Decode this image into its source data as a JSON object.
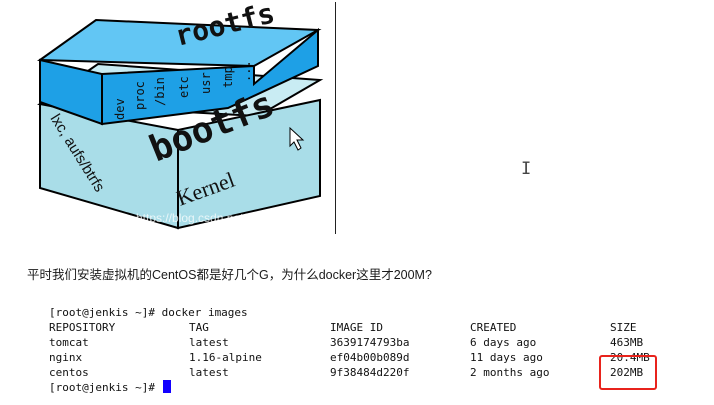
{
  "diagram": {
    "rootfs_label": "rootfs",
    "rootfs_dirs": [
      "dev",
      "proc",
      "/bin",
      "etc",
      "usr",
      "tmp",
      "..."
    ],
    "bootfs_label": "bootfs",
    "lxc_label": "lxc, aufs/btrfs",
    "kernel_label": "Kernel",
    "watermark": "https://blog.csdn.net/pjsdsg",
    "colors": {
      "rootfs_front": "#1ea0e6",
      "rootfs_top": "#62c6f4",
      "rootfs_side": "#0f6fb5",
      "bootfs_front": "#a9dde8",
      "bootfs_top": "#c9ecf3",
      "bootfs_side": "#7cc4d3"
    }
  },
  "question": "平时我们安装虚拟机的CentOS都是好几个G，为什么docker这里才200M?",
  "terminal": {
    "prompt1": "[root@jenkis ~]# docker images",
    "headers": [
      "REPOSITORY",
      "TAG",
      "IMAGE ID",
      "CREATED",
      "SIZE"
    ],
    "rows": [
      [
        "tomcat",
        "latest",
        "3639174793ba",
        "6 days ago",
        "463MB"
      ],
      [
        "nginx",
        "1.16-alpine",
        "ef04b00b089d",
        "11 days ago",
        "20.4MB"
      ],
      [
        "centos",
        "latest",
        "9f38484d220f",
        "2 months ago",
        "202MB"
      ]
    ],
    "prompt2": "[root@jenkis ~]# ",
    "cursor_color": "#1300ff"
  },
  "highlight_color": "#e8231c",
  "icons": [
    "mouse-pointer-icon",
    "text-cursor-icon"
  ]
}
